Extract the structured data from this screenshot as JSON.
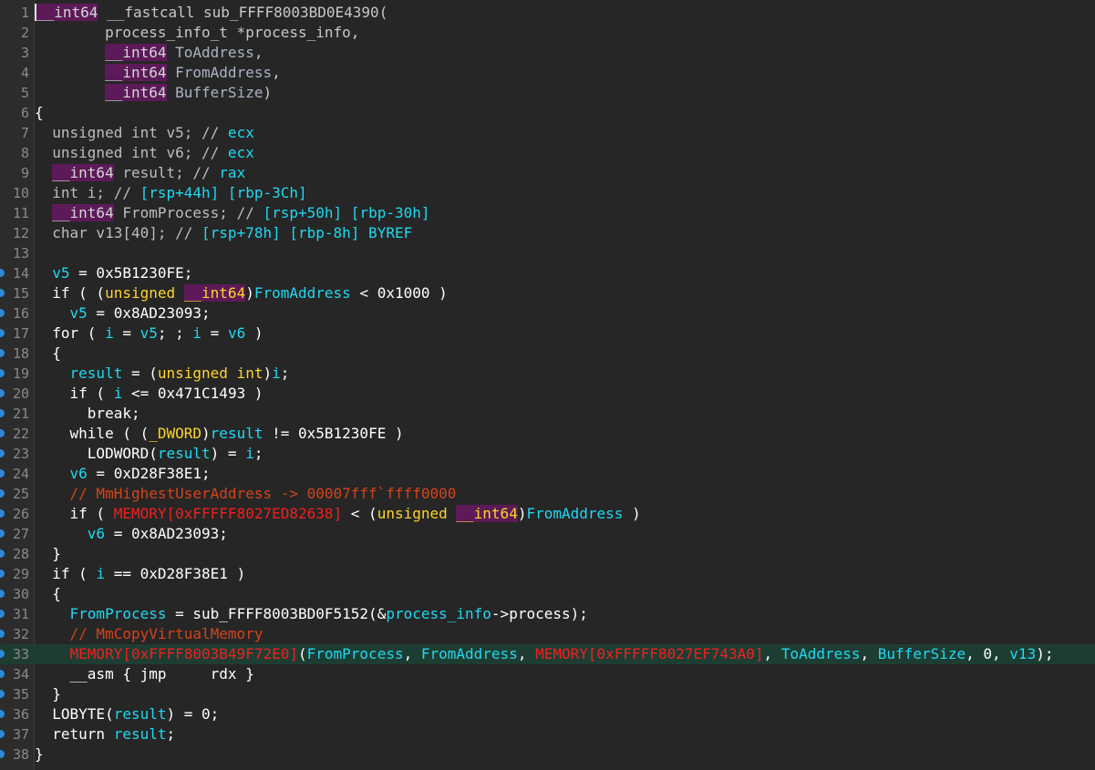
{
  "editor": {
    "current_line": 33,
    "lines": [
      {
        "n": "1",
        "t": [
          [
            "t",
            "__int64"
          ],
          [
            "f",
            " __fastcall sub_FFFF8003BD0E4390("
          ]
        ]
      },
      {
        "n": "2",
        "t": [
          [
            "f",
            "        process_info_t *process_info,"
          ]
        ]
      },
      {
        "n": "3",
        "t": [
          [
            "f",
            "        "
          ],
          [
            "t",
            "__int64"
          ],
          [
            "vp",
            " ToAddress"
          ],
          [
            "f",
            ","
          ]
        ]
      },
      {
        "n": "4",
        "t": [
          [
            "f",
            "        "
          ],
          [
            "t",
            "__int64"
          ],
          [
            "vp",
            " FromAddress"
          ],
          [
            "f",
            ","
          ]
        ]
      },
      {
        "n": "5",
        "t": [
          [
            "f",
            "        "
          ],
          [
            "t",
            "__int64"
          ],
          [
            "vp",
            " BufferSize"
          ],
          [
            "f",
            ")"
          ]
        ]
      },
      {
        "n": "6",
        "t": [
          [
            "w",
            "{"
          ]
        ]
      },
      {
        "n": "7",
        "t": [
          [
            "k",
            "  unsigned int v5; // "
          ],
          [
            "v",
            "ecx"
          ]
        ]
      },
      {
        "n": "8",
        "t": [
          [
            "k",
            "  unsigned int v6; // "
          ],
          [
            "v",
            "ecx"
          ]
        ]
      },
      {
        "n": "9",
        "t": [
          [
            "f",
            "  "
          ],
          [
            "t",
            "__int64"
          ],
          [
            "k",
            " result; // "
          ],
          [
            "v",
            "rax"
          ]
        ]
      },
      {
        "n": "10",
        "t": [
          [
            "k",
            "  int i; // "
          ],
          [
            "v",
            "[rsp+44h] [rbp-3Ch]"
          ]
        ]
      },
      {
        "n": "11",
        "t": [
          [
            "f",
            "  "
          ],
          [
            "t",
            "__int64"
          ],
          [
            "k",
            " FromProcess; // "
          ],
          [
            "v",
            "[rsp+50h] [rbp-30h]"
          ]
        ]
      },
      {
        "n": "12",
        "t": [
          [
            "k",
            "  char v13[40]; // "
          ],
          [
            "v",
            "[rsp+78h] [rbp-8h] BYREF"
          ]
        ]
      },
      {
        "n": "13",
        "t": []
      },
      {
        "n": "14",
        "dot": true,
        "t": [
          [
            "v",
            "  v5"
          ],
          [
            "w",
            " = 0x5B1230FE;"
          ]
        ]
      },
      {
        "n": "15",
        "dot": true,
        "t": [
          [
            "w",
            "  if ( ("
          ],
          [
            "ty",
            "unsigned "
          ],
          [
            "tyh",
            "__int64"
          ],
          [
            "w",
            ")"
          ],
          [
            "v",
            "FromAddress"
          ],
          [
            "w",
            " < 0x1000 )"
          ]
        ]
      },
      {
        "n": "16",
        "dot": true,
        "t": [
          [
            "v",
            "    v5"
          ],
          [
            "w",
            " = 0x8AD23093;"
          ]
        ]
      },
      {
        "n": "17",
        "dot": true,
        "t": [
          [
            "w",
            "  for ( "
          ],
          [
            "v",
            "i"
          ],
          [
            "w",
            " = "
          ],
          [
            "v",
            "v5"
          ],
          [
            "w",
            "; ; "
          ],
          [
            "v",
            "i"
          ],
          [
            "w",
            " = "
          ],
          [
            "v",
            "v6"
          ],
          [
            "w",
            " )"
          ]
        ]
      },
      {
        "n": "18",
        "dot": true,
        "t": [
          [
            "w",
            "  {"
          ]
        ]
      },
      {
        "n": "19",
        "dot": true,
        "t": [
          [
            "v",
            "    result"
          ],
          [
            "w",
            " = ("
          ],
          [
            "ty",
            "unsigned int"
          ],
          [
            "w",
            ")"
          ],
          [
            "v",
            "i"
          ],
          [
            "w",
            ";"
          ]
        ]
      },
      {
        "n": "20",
        "dot": true,
        "t": [
          [
            "w",
            "    if ( "
          ],
          [
            "v",
            "i"
          ],
          [
            "w",
            " <= 0x471C1493 )"
          ]
        ]
      },
      {
        "n": "21",
        "dot": true,
        "t": [
          [
            "w",
            "      break;"
          ]
        ]
      },
      {
        "n": "22",
        "dot": true,
        "t": [
          [
            "w",
            "    while ( ("
          ],
          [
            "ty",
            "_DWORD"
          ],
          [
            "w",
            ")"
          ],
          [
            "v",
            "result"
          ],
          [
            "w",
            " != 0x5B1230FE )"
          ]
        ]
      },
      {
        "n": "23",
        "dot": true,
        "t": [
          [
            "w",
            "      LODWORD("
          ],
          [
            "v",
            "result"
          ],
          [
            "w",
            ") = "
          ],
          [
            "v",
            "i"
          ],
          [
            "w",
            ";"
          ]
        ]
      },
      {
        "n": "24",
        "dot": true,
        "t": [
          [
            "v",
            "    v6"
          ],
          [
            "w",
            " = 0xD28F38E1;"
          ]
        ]
      },
      {
        "n": "25",
        "dot": true,
        "t": [
          [
            "c",
            "    // MmHighestUserAddress -> 00007fff`ffff0000"
          ]
        ]
      },
      {
        "n": "26",
        "dot": true,
        "t": [
          [
            "w",
            "    if ( "
          ],
          [
            "m",
            "MEMORY[0xFFFFF8027ED82638]"
          ],
          [
            "w",
            " < ("
          ],
          [
            "ty",
            "unsigned "
          ],
          [
            "tyh",
            "__int64"
          ],
          [
            "w",
            ")"
          ],
          [
            "v",
            "FromAddress"
          ],
          [
            "w",
            " )"
          ]
        ]
      },
      {
        "n": "27",
        "dot": true,
        "t": [
          [
            "v",
            "      v6"
          ],
          [
            "w",
            " = 0x8AD23093;"
          ]
        ]
      },
      {
        "n": "28",
        "dot": true,
        "t": [
          [
            "w",
            "  }"
          ]
        ]
      },
      {
        "n": "29",
        "dot": true,
        "t": [
          [
            "w",
            "  if ( "
          ],
          [
            "v",
            "i"
          ],
          [
            "w",
            " == 0xD28F38E1 )"
          ]
        ]
      },
      {
        "n": "30",
        "dot": true,
        "t": [
          [
            "w",
            "  {"
          ]
        ]
      },
      {
        "n": "31",
        "dot": true,
        "t": [
          [
            "v",
            "    FromProcess"
          ],
          [
            "w",
            " = sub_FFFF8003BD0F5152(&"
          ],
          [
            "v",
            "process_info"
          ],
          [
            "w",
            "->process);"
          ]
        ]
      },
      {
        "n": "32",
        "dot": true,
        "t": [
          [
            "c",
            "    // MmCopyVirtualMemory"
          ]
        ]
      },
      {
        "n": "33",
        "dot": true,
        "t": [
          [
            "m",
            "    MEMORY[0xFFFF8003B49F72E0]"
          ],
          [
            "w",
            "("
          ],
          [
            "v",
            "FromProcess"
          ],
          [
            "w",
            ", "
          ],
          [
            "v",
            "FromAddress"
          ],
          [
            "w",
            ", "
          ],
          [
            "m",
            "MEMORY[0xFFFFF8027EF743A0]"
          ],
          [
            "w",
            ", "
          ],
          [
            "v",
            "ToAddress"
          ],
          [
            "w",
            ", "
          ],
          [
            "v",
            "BufferSize"
          ],
          [
            "w",
            ", 0, "
          ],
          [
            "v",
            "v13"
          ],
          [
            "w",
            ");"
          ]
        ]
      },
      {
        "n": "34",
        "dot": true,
        "t": [
          [
            "w",
            "    __asm { jmp     rdx }"
          ]
        ]
      },
      {
        "n": "35",
        "dot": true,
        "t": [
          [
            "w",
            "  }"
          ]
        ]
      },
      {
        "n": "36",
        "dot": true,
        "t": [
          [
            "w",
            "  LOBYTE("
          ],
          [
            "v",
            "result"
          ],
          [
            "w",
            ") = 0;"
          ]
        ]
      },
      {
        "n": "37",
        "dot": true,
        "t": [
          [
            "w",
            "  return "
          ],
          [
            "v",
            "result"
          ],
          [
            "w",
            ";"
          ]
        ]
      },
      {
        "n": "38",
        "dot": true,
        "t": [
          [
            "w",
            "}"
          ]
        ]
      }
    ]
  },
  "colors": {
    "background": "#262626",
    "keyword_highlight": "#5d1a58",
    "variable": "#20d8f0",
    "type": "#ffd42a",
    "comment": "#d6431b",
    "memory": "#f02020",
    "current_line": "#1e3d32",
    "breakpoint_dot": "#2f88d8"
  }
}
